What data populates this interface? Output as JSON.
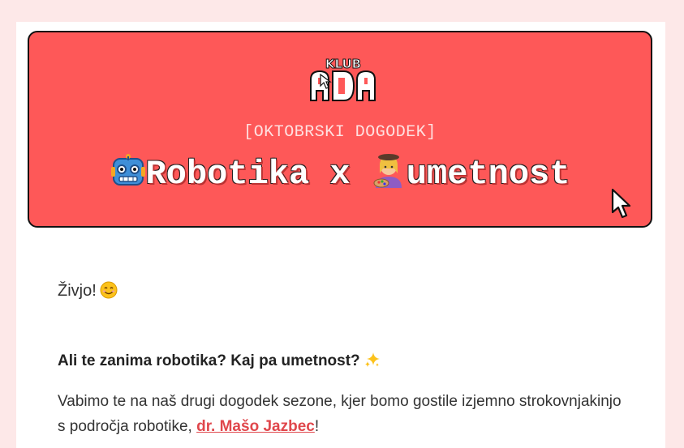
{
  "banner": {
    "logo_text": "KLUB",
    "logo_brand": "ADA",
    "kicker": "[OKTOBRSKI DOGODEK]",
    "title_part1": "Robotika x ",
    "title_part2": "umetnost",
    "emoji_left": "robot-face",
    "emoji_right": "woman-artist"
  },
  "body": {
    "greeting": "Živjo!",
    "greeting_emoji": "smiling-face",
    "question": "Ali te zanima robotika? Kaj pa umetnost?",
    "question_emoji": "sparkles",
    "paragraph_part1": "Vabimo te na naš drugi dogodek sezone, kjer bomo gostile izjemno strokovnjakinjo s področja robotike, ",
    "link_text": "dr. Mašo Jazbec",
    "paragraph_end": "!"
  },
  "colors": {
    "background": "#fde8e8",
    "banner": "#fe5858",
    "link": "#e0474c"
  }
}
